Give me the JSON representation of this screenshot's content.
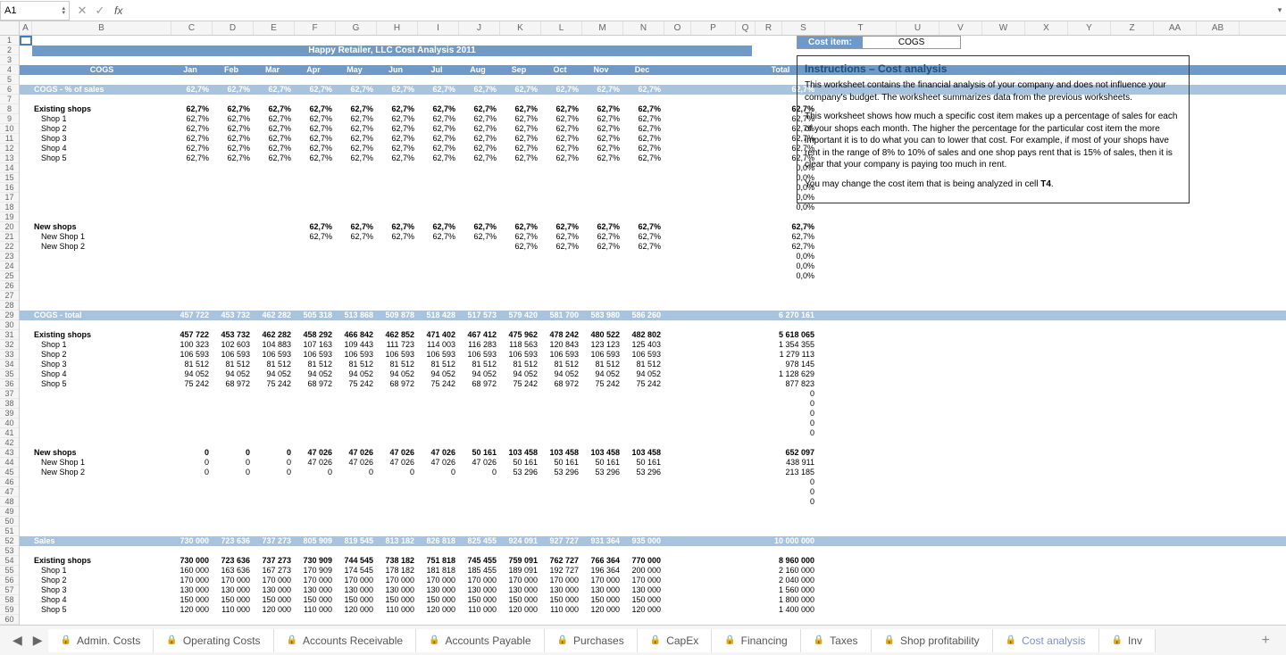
{
  "cell_ref": "A1",
  "title": "Happy Retailer, LLC Cost Analysis 2011",
  "months": [
    "Jan",
    "Feb",
    "Mar",
    "Apr",
    "May",
    "Jun",
    "Jul",
    "Aug",
    "Sep",
    "Oct",
    "Nov",
    "Dec"
  ],
  "total_label": "Total",
  "cogs_label": "COGS",
  "cost_item_label": "Cost item:",
  "cost_item_value": "COGS",
  "section1": {
    "header": "COGS - % of sales",
    "summary_pct": "62,7%",
    "existing_label": "Existing shops",
    "existing_total": "62,7%",
    "shops": [
      "Shop 1",
      "Shop 2",
      "Shop 3",
      "Shop 4",
      "Shop 5"
    ],
    "shop_pct": "62,7%",
    "zero_pct": "0,0%",
    "new_label": "New shops",
    "new_months": [
      null,
      null,
      null,
      "62,7%",
      "62,7%",
      "62,7%",
      "62,7%",
      "62,7%",
      "62,7%",
      "62,7%",
      "62,7%",
      "62,7%"
    ],
    "new_total": "62,7%",
    "newshop1": "New Shop 1",
    "newshop1_months": [
      null,
      null,
      null,
      "62,7%",
      "62,7%",
      "62,7%",
      "62,7%",
      "62,7%",
      "62,7%",
      "62,7%",
      "62,7%",
      "62,7%"
    ],
    "newshop1_total": "62,7%",
    "newshop2": "New Shop 2",
    "newshop2_months": [
      null,
      null,
      null,
      null,
      null,
      null,
      null,
      null,
      "62,7%",
      "62,7%",
      "62,7%",
      "62,7%"
    ],
    "newshop2_total": "62,7%"
  },
  "section2": {
    "header": "COGS - total",
    "summary": [
      "457 722",
      "453 732",
      "462 282",
      "505 318",
      "513 868",
      "509 878",
      "518 428",
      "517 573",
      "579 420",
      "581 700",
      "583 980",
      "586 260"
    ],
    "summary_total": "6 270 161",
    "existing_label": "Existing shops",
    "existing": [
      "457 722",
      "453 732",
      "462 282",
      "458 292",
      "466 842",
      "462 852",
      "471 402",
      "467 412",
      "475 962",
      "478 242",
      "480 522",
      "482 802"
    ],
    "existing_total": "5 618 065",
    "rows": [
      {
        "name": "Shop 1",
        "vals": [
          "100 323",
          "102 603",
          "104 883",
          "107 163",
          "109 443",
          "111 723",
          "114 003",
          "116 283",
          "118 563",
          "120 843",
          "123 123",
          "125 403"
        ],
        "total": "1 354 355"
      },
      {
        "name": "Shop 2",
        "vals": [
          "106 593",
          "106 593",
          "106 593",
          "106 593",
          "106 593",
          "106 593",
          "106 593",
          "106 593",
          "106 593",
          "106 593",
          "106 593",
          "106 593"
        ],
        "total": "1 279 113"
      },
      {
        "name": "Shop 3",
        "vals": [
          "81 512",
          "81 512",
          "81 512",
          "81 512",
          "81 512",
          "81 512",
          "81 512",
          "81 512",
          "81 512",
          "81 512",
          "81 512",
          "81 512"
        ],
        "total": "978 145"
      },
      {
        "name": "Shop 4",
        "vals": [
          "94 052",
          "94 052",
          "94 052",
          "94 052",
          "94 052",
          "94 052",
          "94 052",
          "94 052",
          "94 052",
          "94 052",
          "94 052",
          "94 052"
        ],
        "total": "1 128 629"
      },
      {
        "name": "Shop 5",
        "vals": [
          "75 242",
          "68 972",
          "75 242",
          "68 972",
          "75 242",
          "68 972",
          "75 242",
          "68 972",
          "75 242",
          "68 972",
          "75 242",
          "75 242"
        ],
        "total": "877 823"
      }
    ],
    "zero": "0",
    "new_label": "New shops",
    "new": [
      "0",
      "0",
      "0",
      "47 026",
      "47 026",
      "47 026",
      "47 026",
      "50 161",
      "103 458",
      "103 458",
      "103 458",
      "103 458"
    ],
    "new_total": "652 097",
    "newshop1": {
      "name": "New Shop 1",
      "vals": [
        "0",
        "0",
        "0",
        "47 026",
        "47 026",
        "47 026",
        "47 026",
        "47 026",
        "50 161",
        "50 161",
        "50 161",
        "50 161"
      ],
      "total": "438 911"
    },
    "newshop2": {
      "name": "New Shop 2",
      "vals": [
        "0",
        "0",
        "0",
        "0",
        "0",
        "0",
        "0",
        "0",
        "53 296",
        "53 296",
        "53 296",
        "53 296"
      ],
      "total": "213 185"
    }
  },
  "section3": {
    "header": "Sales",
    "summary": [
      "730 000",
      "723 636",
      "737 273",
      "805 909",
      "819 545",
      "813 182",
      "826 818",
      "825 455",
      "924 091",
      "927 727",
      "931 364",
      "935 000"
    ],
    "summary_total": "10 000 000",
    "existing_label": "Existing shops",
    "existing": [
      "730 000",
      "723 636",
      "737 273",
      "730 909",
      "744 545",
      "738 182",
      "751 818",
      "745 455",
      "759 091",
      "762 727",
      "766 364",
      "770 000"
    ],
    "existing_total": "8 960 000",
    "rows": [
      {
        "name": "Shop 1",
        "vals": [
          "160 000",
          "163 636",
          "167 273",
          "170 909",
          "174 545",
          "178 182",
          "181 818",
          "185 455",
          "189 091",
          "192 727",
          "196 364",
          "200 000"
        ],
        "total": "2 160 000"
      },
      {
        "name": "Shop 2",
        "vals": [
          "170 000",
          "170 000",
          "170 000",
          "170 000",
          "170 000",
          "170 000",
          "170 000",
          "170 000",
          "170 000",
          "170 000",
          "170 000",
          "170 000"
        ],
        "total": "2 040 000"
      },
      {
        "name": "Shop 3",
        "vals": [
          "130 000",
          "130 000",
          "130 000",
          "130 000",
          "130 000",
          "130 000",
          "130 000",
          "130 000",
          "130 000",
          "130 000",
          "130 000",
          "130 000"
        ],
        "total": "1 560 000"
      },
      {
        "name": "Shop 4",
        "vals": [
          "150 000",
          "150 000",
          "150 000",
          "150 000",
          "150 000",
          "150 000",
          "150 000",
          "150 000",
          "150 000",
          "150 000",
          "150 000",
          "150 000"
        ],
        "total": "1 800 000"
      },
      {
        "name": "Shop 5",
        "vals": [
          "120 000",
          "110 000",
          "120 000",
          "110 000",
          "120 000",
          "110 000",
          "120 000",
          "110 000",
          "120 000",
          "110 000",
          "120 000",
          "120 000"
        ],
        "total": "1 400 000"
      }
    ]
  },
  "instructions": {
    "title": "Instructions – Cost analysis",
    "p1": "This worksheet contains the financial analysis of your company and does not influence your company's budget. The worksheet summarizes data from the previous worksheets.",
    "p2": "This worksheet shows how much a specific cost item makes up a percentage of sales for each of your shops each month. The higher the percentage for the particular cost item the more important it is to do what you can to lower that cost. For example, if most of your shops have rent in the range of 8% to 10% of sales and one shop pays rent that is 15% of sales, then it is clear that your company is paying too much in rent.",
    "p3": "You may change the cost item that is being analyzed in cell T4."
  },
  "tabs": [
    "Admin. Costs",
    "Operating Costs",
    "Accounts Receivable",
    "Accounts Payable",
    "Purchases",
    "CapEx",
    "Financing",
    "Taxes",
    "Shop profitability",
    "Cost analysis",
    "Inv"
  ],
  "active_tab": 9,
  "col_letters": [
    "A",
    "B",
    "C",
    "D",
    "E",
    "F",
    "G",
    "H",
    "I",
    "J",
    "K",
    "L",
    "M",
    "N",
    "O",
    "P",
    "Q",
    "R",
    "S",
    "T",
    "U",
    "V",
    "W",
    "X",
    "Y",
    "Z",
    "AA",
    "AB"
  ]
}
